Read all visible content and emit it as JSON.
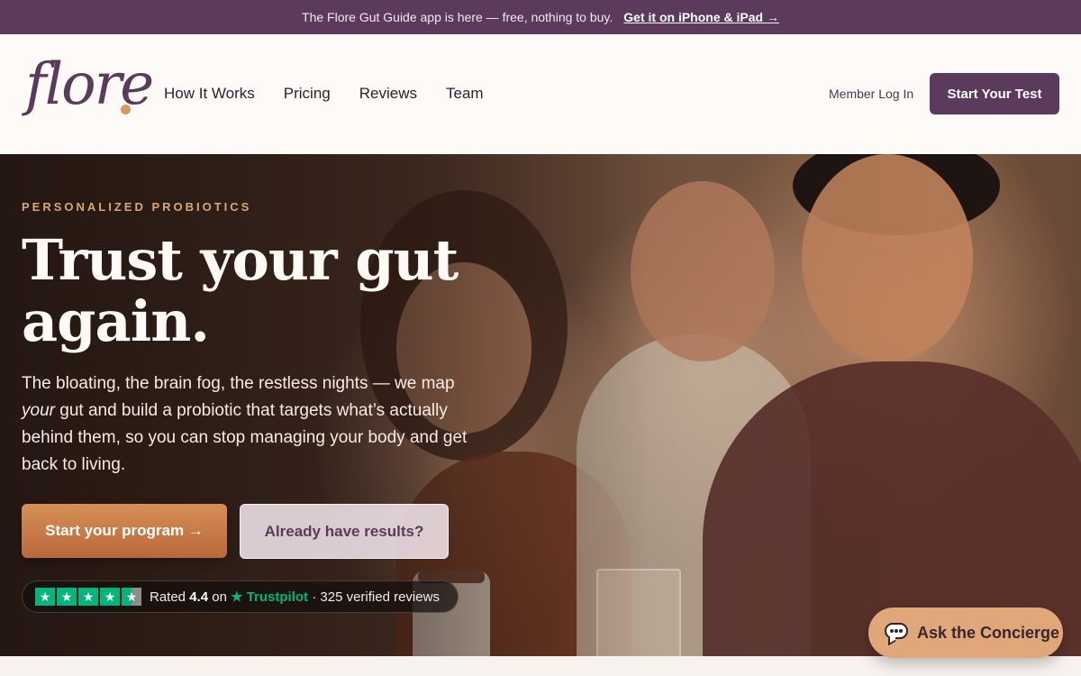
{
  "announcement": {
    "text": "The Flore Gut Guide app is here — free, nothing to buy.",
    "link_label": "Get it on iPhone & iPad →"
  },
  "header": {
    "logo_text": "flore",
    "nav": [
      {
        "label": "How It Works"
      },
      {
        "label": "Pricing"
      },
      {
        "label": "Reviews"
      },
      {
        "label": "Team"
      }
    ],
    "member_login_label": "Member Log In",
    "start_test_label": "Start Your Test"
  },
  "hero": {
    "eyebrow": "PERSONALIZED PROBIOTICS",
    "headline": "Trust your gut again.",
    "lede_part1": "The bloating, the brain fog, the restless nights — we map ",
    "lede_emphasis": "your",
    "lede_part2": " gut and build a probiotic that targets what’s actually behind them, so you can stop managing your body and get back to living.",
    "primary_cta": "Start your program →",
    "secondary_cta": "Already have results?",
    "rating": {
      "prefix": "Rated",
      "score": "4.4",
      "on": "on",
      "brand": "★ Trustpilot",
      "suffix": "· 325 verified reviews",
      "stars_filled": 4.5
    }
  },
  "concierge": {
    "label": "Ask the Concierge",
    "icon": "chat-bubble-icon"
  },
  "colors": {
    "brand_purple": "#5b3a5c",
    "accent_orange": "#d88f56",
    "trustpilot_green": "#00b67a"
  }
}
